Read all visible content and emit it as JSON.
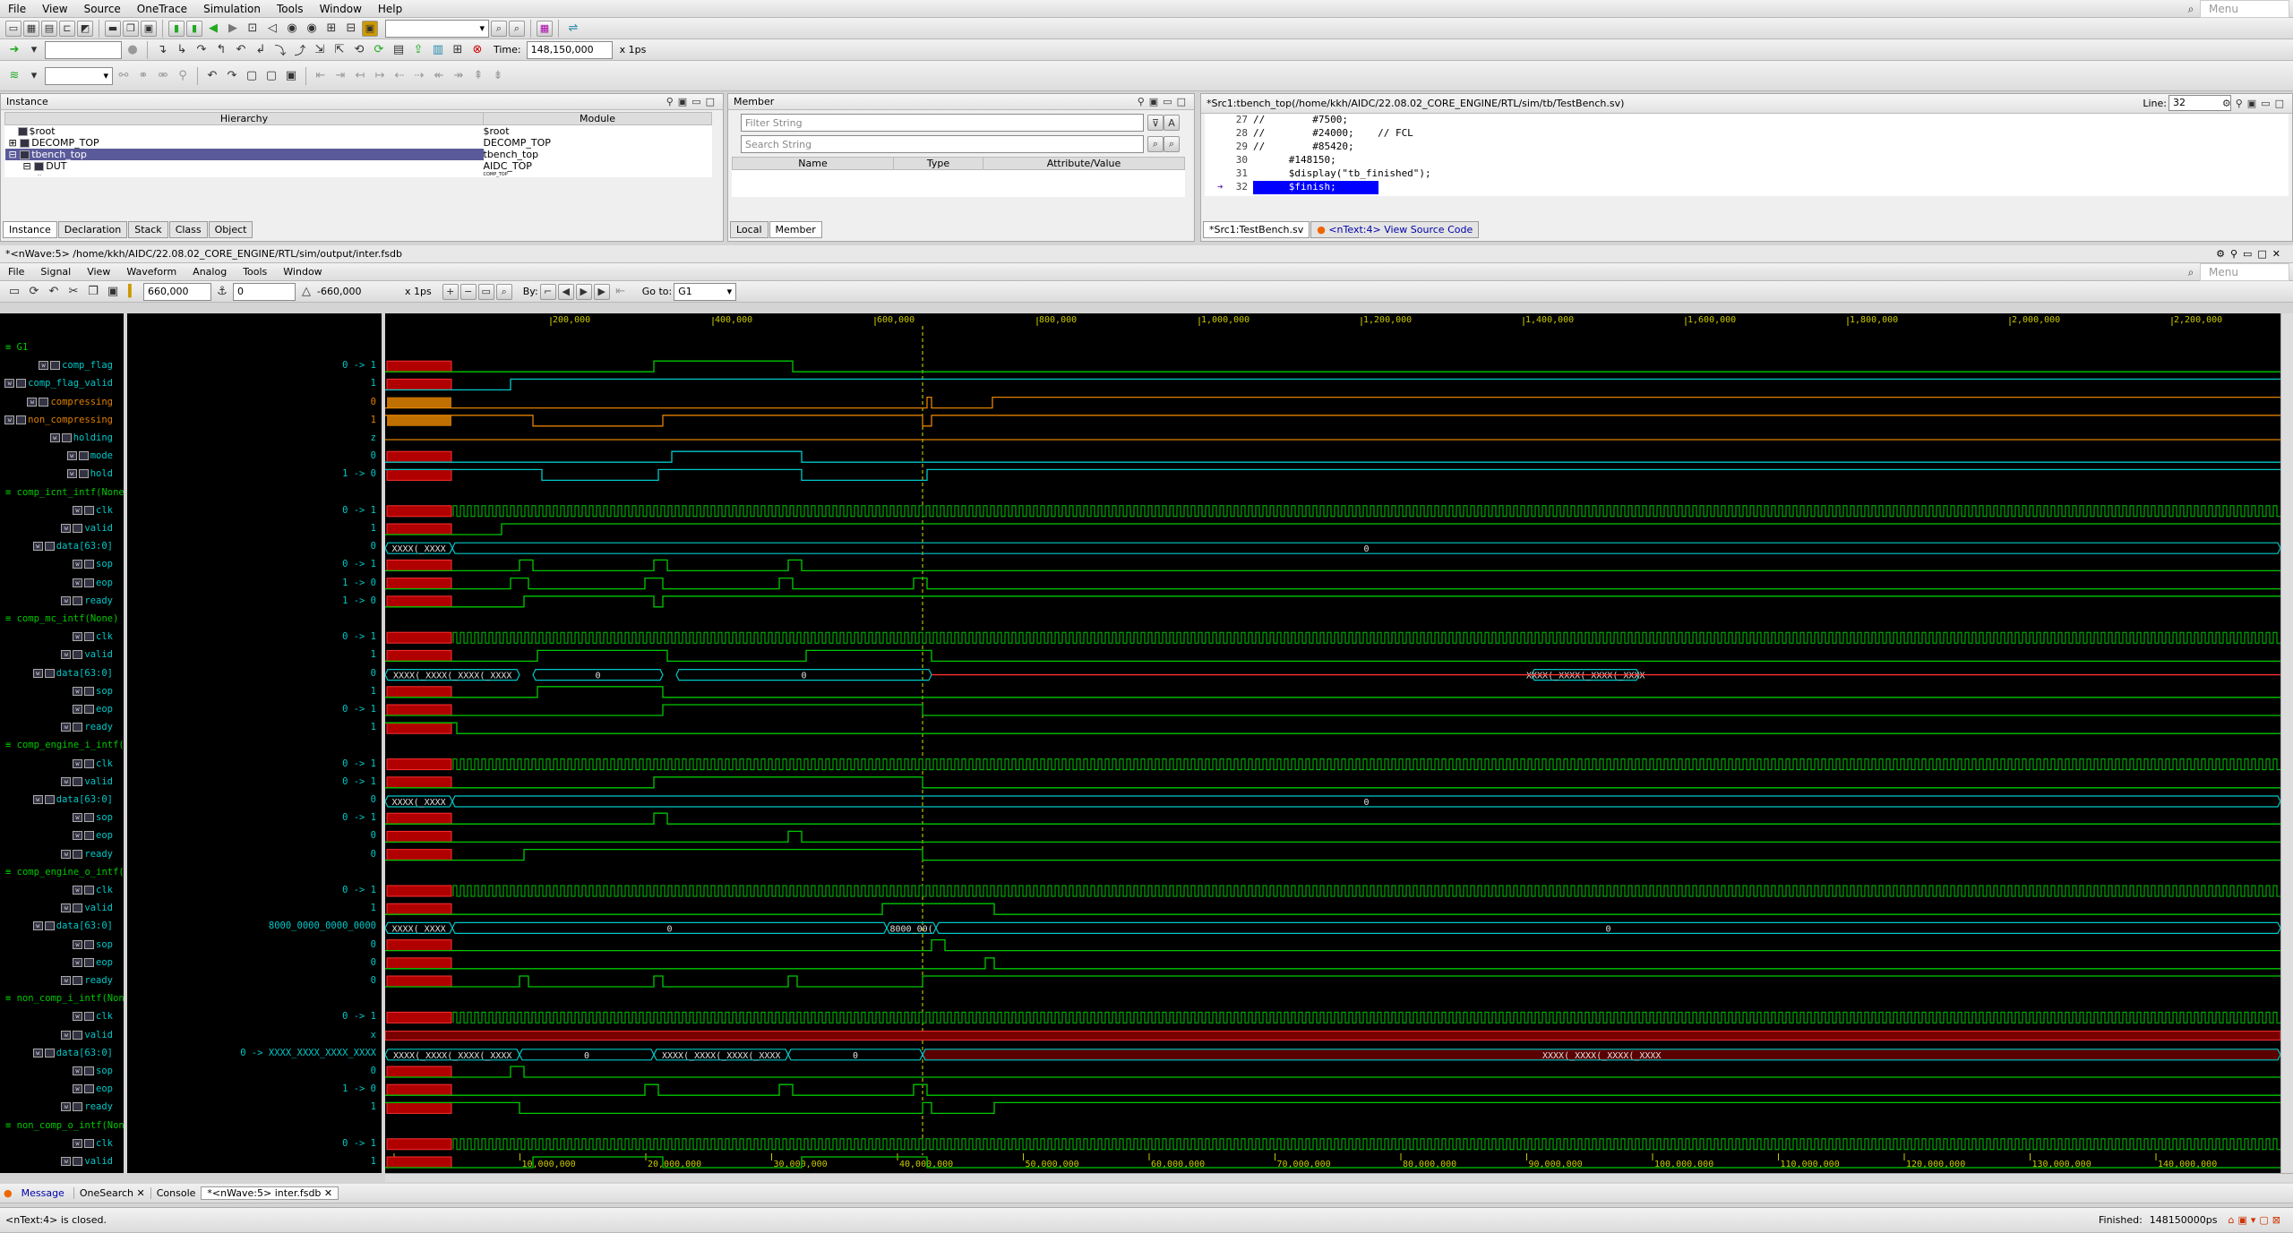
{
  "menu": [
    "File",
    "View",
    "Source",
    "OneTrace",
    "Simulation",
    "Tools",
    "Window",
    "Help"
  ],
  "top_search_placeholder": "Menu",
  "time_label": "Time:",
  "time_value": "148,150,000",
  "time_unit": "x 1ps",
  "instance_panel": {
    "title": "Instance",
    "col_hier": "Hierarchy",
    "col_mod": "Module",
    "rows": [
      {
        "h": "$root",
        "m": "$root"
      },
      {
        "h": "DECOMP_TOP",
        "m": "DECOMP_TOP"
      },
      {
        "h": "tbench_top",
        "m": "tbench_top"
      },
      {
        "h": "DUT",
        "m": "AIDC_TOP"
      },
      {
        "h": "...",
        "m": "COMP_TOP"
      }
    ],
    "tabs": [
      "Instance",
      "Declaration",
      "Stack",
      "Class",
      "Object"
    ]
  },
  "member_panel": {
    "title": "Member",
    "filter_placeholder": "Filter String",
    "search_placeholder": "Search String",
    "cols": [
      "Name",
      "Type",
      "Attribute/Value"
    ],
    "tabs": [
      "Local",
      "Member"
    ]
  },
  "source_panel": {
    "title": "*Src1:tbench_top(/home/kkh/AIDC/22.08.02_CORE_ENGINE/RTL/sim/tb/TestBench.sv)",
    "line_label": "Line:",
    "line_value": "32",
    "lines": [
      {
        "n": "27",
        "t": "//        #7500;"
      },
      {
        "n": "28",
        "t": "//        #24000;    // FCL"
      },
      {
        "n": "29",
        "t": "//        #85420;"
      },
      {
        "n": "30",
        "t": "      #148150;"
      },
      {
        "n": "31",
        "t": "      $display(\"tb_finished\");"
      },
      {
        "n": "32",
        "t": "      $finish;"
      }
    ],
    "tabs": [
      "*Src1:TestBench.sv",
      "<nText:4> View Source Code"
    ]
  },
  "nwave": {
    "title": "*<nWave:5> /home/kkh/AIDC/22.08.02_CORE_ENGINE/RTL/sim/output/inter.fsdb",
    "menu": [
      "File",
      "Signal",
      "View",
      "Waveform",
      "Analog",
      "Tools",
      "Window"
    ],
    "cursor": "660,000",
    "marker": "0",
    "delta": "-660,000",
    "unit": "x 1ps",
    "by_label": "By:",
    "goto_label": "Go to:",
    "goto_value": "G1",
    "search_placeholder": "Menu",
    "top_ticks": [
      "200,000",
      "400,000",
      "600,000",
      "800,000",
      "1,000,000",
      "1,200,000",
      "1,400,000",
      "1,600,000",
      "1,800,000",
      "2,000,000",
      "2,200,000"
    ],
    "bottom_ticks": [
      "0",
      "10,000,000",
      "20,000,000",
      "30,000,000",
      "40,000,000",
      "50,000,000",
      "60,000,000",
      "70,000,000",
      "80,000,000",
      "90,000,000",
      "100,000,000",
      "110,000,000",
      "120,000,000",
      "130,000,000",
      "140,000,000"
    ]
  },
  "signals": [
    {
      "kind": "group",
      "name": "G1"
    },
    {
      "name": "comp_flag",
      "val": "0 -> 1",
      "c": "#00c8c8"
    },
    {
      "name": "comp_flag_valid",
      "val": "1",
      "c": "#00c8c8"
    },
    {
      "name": "compressing",
      "val": "0",
      "c": "#e08000"
    },
    {
      "name": "non_compressing",
      "val": "1",
      "c": "#e08000"
    },
    {
      "name": "holding",
      "val": "z",
      "c": "#00c8c8"
    },
    {
      "name": "mode",
      "val": "0",
      "c": "#00c8c8"
    },
    {
      "name": "hold",
      "val": "1 -> 0",
      "c": "#00c8c8"
    },
    {
      "kind": "group",
      "name": "comp_icnt_intf(None)"
    },
    {
      "name": "clk",
      "val": "0 -> 1",
      "c": "#00c8c8"
    },
    {
      "name": "valid",
      "val": "1",
      "c": "#00c8c8"
    },
    {
      "name": "data[63:0]",
      "val": "0",
      "c": "#00c8c8"
    },
    {
      "name": "sop",
      "val": "0 -> 1",
      "c": "#00c8c8"
    },
    {
      "name": "eop",
      "val": "1 -> 0",
      "c": "#00c8c8"
    },
    {
      "name": "ready",
      "val": "1 -> 0",
      "c": "#00c8c8"
    },
    {
      "kind": "group",
      "name": "comp_mc_intf(None)"
    },
    {
      "name": "clk",
      "val": "0 -> 1",
      "c": "#00c8c8"
    },
    {
      "name": "valid",
      "val": "1",
      "c": "#00c8c8"
    },
    {
      "name": "data[63:0]",
      "val": "0",
      "c": "#00c8c8"
    },
    {
      "name": "sop",
      "val": "1",
      "c": "#00c8c8"
    },
    {
      "name": "eop",
      "val": "0 -> 1",
      "c": "#00c8c8"
    },
    {
      "name": "ready",
      "val": "1",
      "c": "#00c8c8"
    },
    {
      "kind": "group",
      "name": "comp_engine_i_intf(None)"
    },
    {
      "name": "clk",
      "val": "0 -> 1",
      "c": "#00c8c8"
    },
    {
      "name": "valid",
      "val": "0 -> 1",
      "c": "#00c8c8"
    },
    {
      "name": "data[63:0]",
      "val": "0",
      "c": "#00c8c8"
    },
    {
      "name": "sop",
      "val": "0 -> 1",
      "c": "#00c8c8"
    },
    {
      "name": "eop",
      "val": "0",
      "c": "#00c8c8"
    },
    {
      "name": "ready",
      "val": "0",
      "c": "#00c8c8"
    },
    {
      "kind": "group",
      "name": "comp_engine_o_intf(None)"
    },
    {
      "name": "clk",
      "val": "0 -> 1",
      "c": "#00c8c8"
    },
    {
      "name": "valid",
      "val": "1",
      "c": "#00c8c8"
    },
    {
      "name": "data[63:0]",
      "val": "8000_0000_0000_0000",
      "c": "#00c8c8"
    },
    {
      "name": "sop",
      "val": "0",
      "c": "#00c8c8"
    },
    {
      "name": "eop",
      "val": "0",
      "c": "#00c8c8"
    },
    {
      "name": "ready",
      "val": "0",
      "c": "#00c8c8"
    },
    {
      "kind": "group",
      "name": "non_comp_i_intf(None)"
    },
    {
      "name": "clk",
      "val": "0 -> 1",
      "c": "#00c8c8"
    },
    {
      "name": "valid",
      "val": "x",
      "c": "#00c8c8"
    },
    {
      "name": "data[63:0]",
      "val": "0 -> XXXX_XXXX_XXXX_XXXX",
      "c": "#00c8c8"
    },
    {
      "name": "sop",
      "val": "0",
      "c": "#00c8c8"
    },
    {
      "name": "eop",
      "val": "1 -> 0",
      "c": "#00c8c8"
    },
    {
      "name": "ready",
      "val": "1",
      "c": "#00c8c8"
    },
    {
      "kind": "group",
      "name": "non_comp_o_intf(None)"
    },
    {
      "name": "clk",
      "val": "0 -> 1",
      "c": "#00c8c8"
    },
    {
      "name": "valid",
      "val": "1",
      "c": "#00c8c8"
    }
  ],
  "bus_labels": {
    "zero": "0",
    "xx": "XXXX(_XXXX(_XXXX(_XXXX",
    "hex": "8000_00(",
    "x_short": "XXXX(_XXXX("
  },
  "bottom_tabs": [
    "Message",
    "OneSearch",
    "Console",
    "*<nWave:5> inter.fsdb"
  ],
  "status_left": "<nText:4> is closed.",
  "status_right_label": "Finished:",
  "status_right_value": "148150000ps"
}
